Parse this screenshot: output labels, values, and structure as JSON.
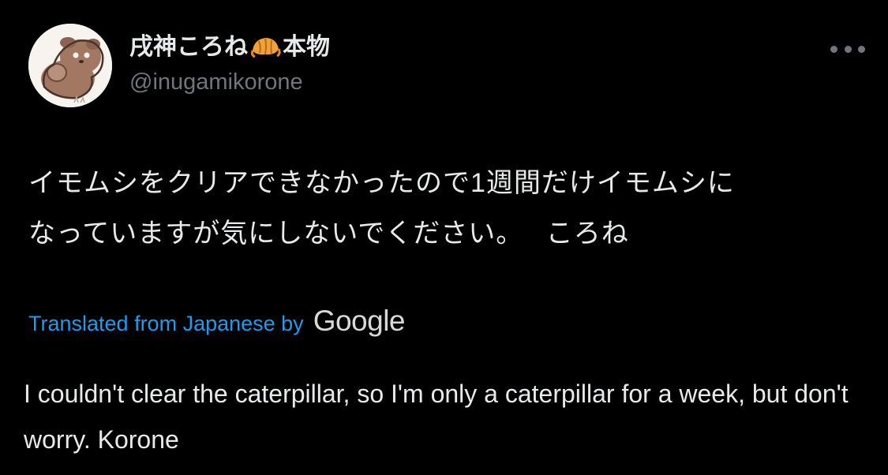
{
  "tweet": {
    "author": {
      "display_name": "戌神ころね",
      "display_name_suffix": "本物",
      "emoji_icon": "croissant-icon",
      "handle": "@inugamikorone",
      "avatar_icon": "dog-mascot-avatar"
    },
    "more_icon": "more-horizontal-icon",
    "text": "イモムシをクリアできなかったので1週間だけイモムシに\nなっていますが気にしないでください。　 ころね",
    "translation": {
      "label": "Translated from Japanese by",
      "provider": "Google",
      "text": "I couldn't clear the caterpillar, so I'm only a caterpillar for a week, but don't worry. Korone"
    }
  },
  "colors": {
    "background": "#000000",
    "primary_text": "#e7e9ea",
    "secondary_text": "#71767b",
    "link": "#1d9bf0"
  }
}
